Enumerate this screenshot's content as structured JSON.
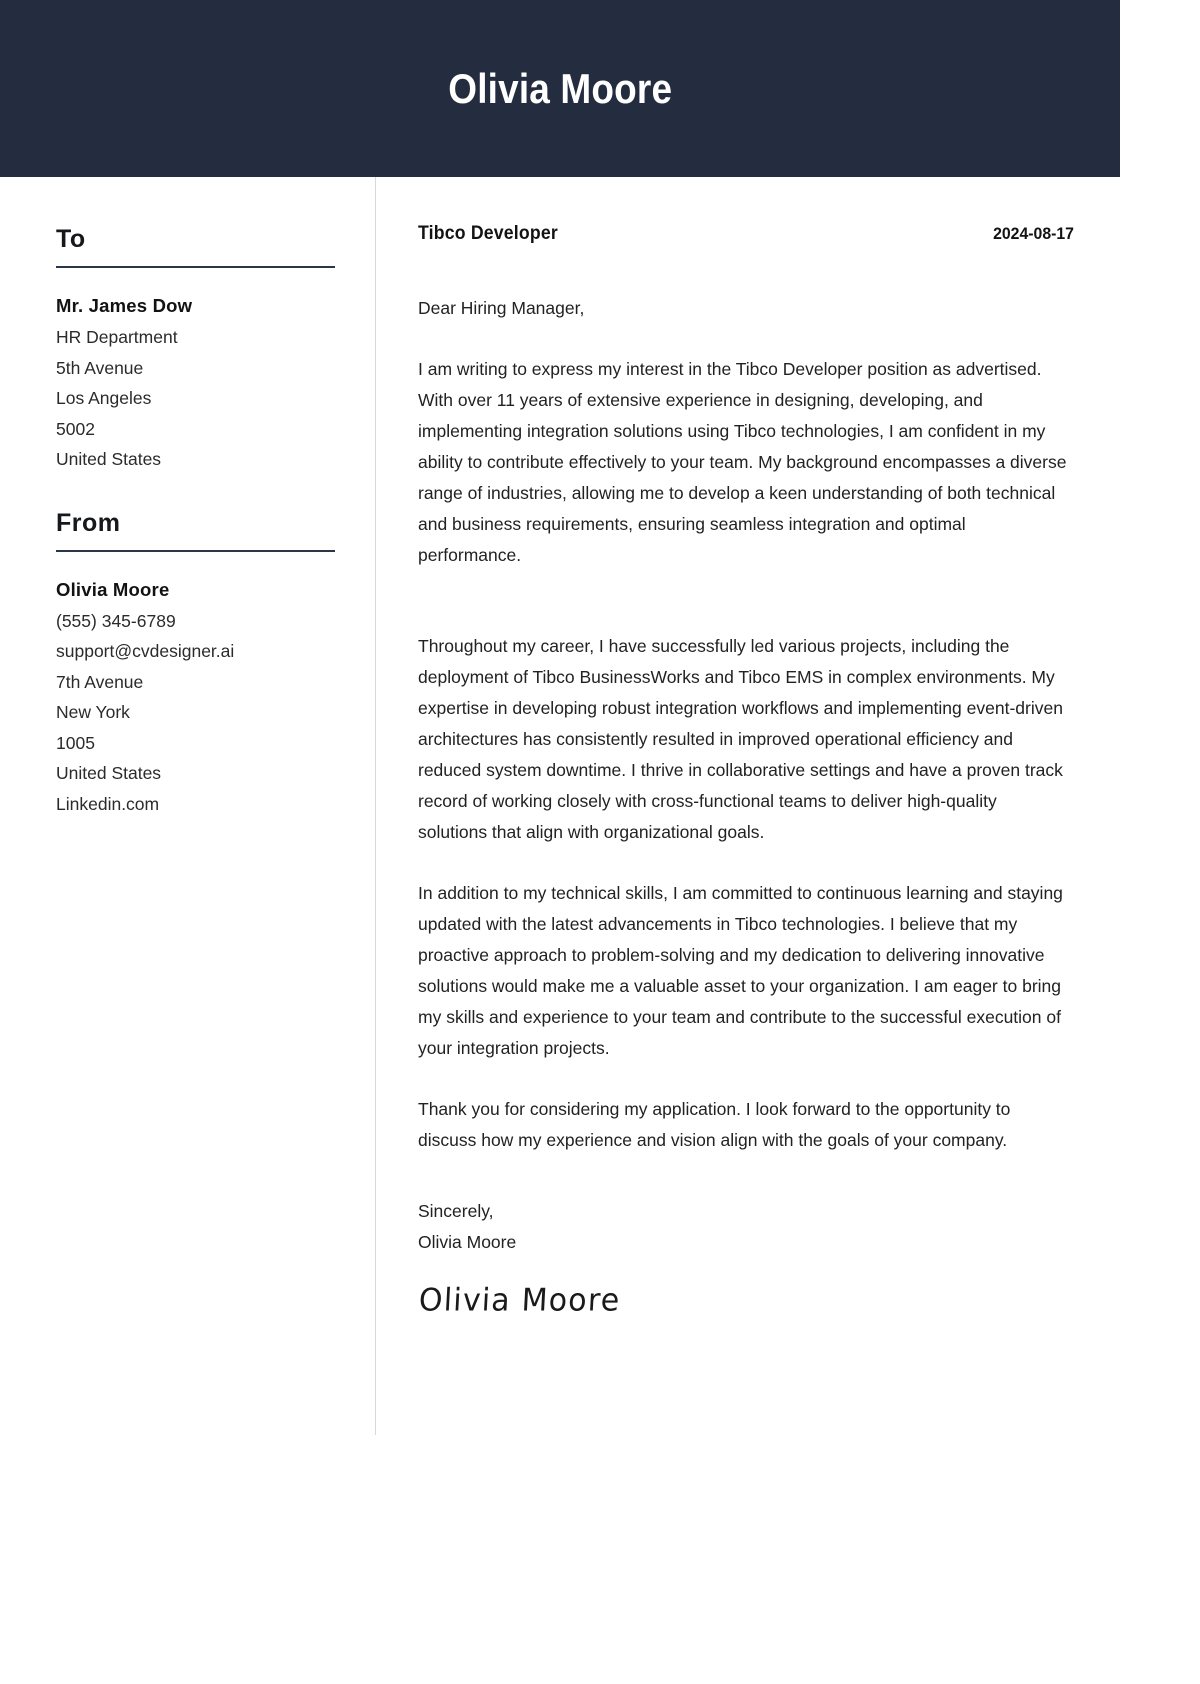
{
  "header": {
    "name": "Olivia Moore"
  },
  "sidebar": {
    "to": {
      "heading": "To",
      "lines": [
        "Mr. James Dow",
        "HR Department",
        "5th Avenue",
        "Los Angeles",
        "5002",
        "United States"
      ]
    },
    "from": {
      "heading": "From",
      "lines": [
        "Olivia Moore",
        "(555) 345-6789",
        "support@cvdesigner.ai",
        "7th Avenue",
        "New York",
        "1005",
        "United States",
        "Linkedin.com"
      ]
    }
  },
  "letter": {
    "job_title": "Tibco Developer",
    "date": "2024-08-17",
    "salutation": "Dear Hiring Manager,",
    "paragraphs": [
      "I am writing to express my interest in the Tibco Developer position as advertised. With over 11 years of extensive experience in designing, developing, and implementing integration solutions using Tibco technologies, I am confident in my ability to contribute effectively to your team. My background encompasses a diverse range of industries, allowing me to develop a keen understanding of both technical and business requirements, ensuring seamless integration and optimal performance.",
      "Throughout my career, I have successfully led various projects, including the deployment of Tibco BusinessWorks and Tibco EMS in complex environments. My expertise in developing robust integration workflows and implementing event-driven architectures has consistently resulted in improved operational efficiency and reduced system downtime. I thrive in collaborative settings and have a proven track record of working closely with cross-functional teams to deliver high-quality solutions that align with organizational goals.",
      "In addition to my technical skills, I am committed to continuous learning and staying updated with the latest advancements in Tibco technologies. I believe that my proactive approach to problem-solving and my dedication to delivering innovative solutions would make me a valuable asset to your organization. I am eager to bring my skills and experience to your team and contribute to the successful execution of your integration projects.",
      "Thank you for considering my application. I look forward to the opportunity to discuss how my experience and vision align with the goals of your company."
    ],
    "closing": "Sincerely,",
    "closing_name": "Olivia Moore",
    "signature": "Olivia Moore"
  },
  "colors": {
    "header_background": "#242d3f",
    "rule": "#2b3648",
    "divider": "#d8d8d8",
    "body_text": "#222222"
  }
}
